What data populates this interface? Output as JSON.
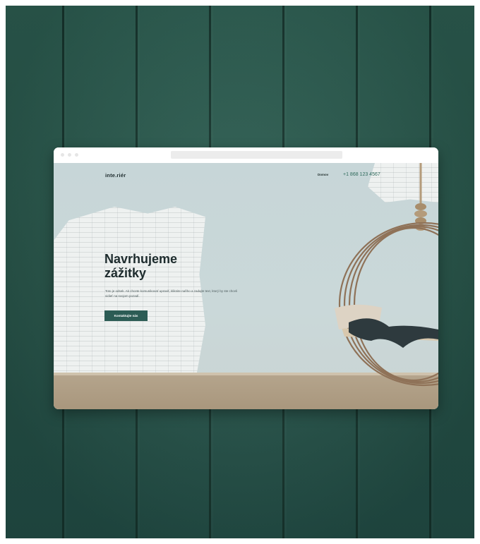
{
  "nav": {
    "logo": "inte.riér",
    "link": "Domov",
    "phone": "+1 868 123 4567"
  },
  "hero": {
    "headline_line1": "Navrhujeme",
    "headline_line2": "zážitky",
    "subtext": "Toto je odsek. Ak chcete komunikovať upraviť, kliknite naňho a zadajte text, ktorý by ste chceli vidieť na svojom pozadí.",
    "cta_label": "Kontaktujte nás"
  },
  "colors": {
    "wall": "#2a5a4e",
    "accent": "#2c5c55",
    "heading": "#1d2b2d",
    "phone": "#2f6a5c"
  },
  "icons": {
    "window_controls": [
      "dot",
      "dot",
      "dot"
    ],
    "swing": "hanging-ring-swing"
  }
}
